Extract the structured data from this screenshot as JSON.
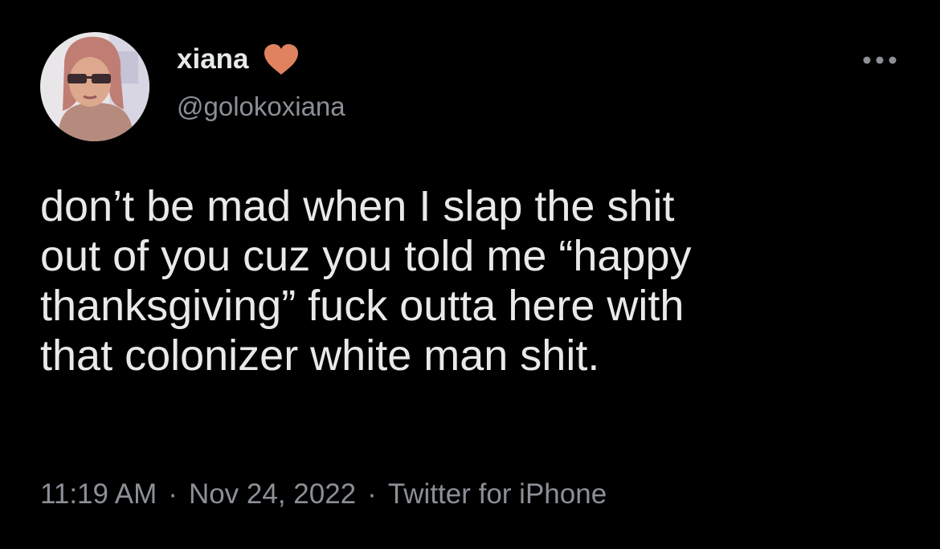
{
  "author": {
    "display_name": "xiana",
    "handle": "@golokoxiana",
    "badge_icon": "heart-icon",
    "badge_color": "#e0825f"
  },
  "menu": {
    "icon": "more-horizontal-icon"
  },
  "tweet": {
    "text_lines": [
      "don’t be mad when I slap the shit",
      "out of you cuz you told me “happy",
      "thanksgiving” fuck outta here with",
      "that colonizer white man shit."
    ],
    "time": "11:19 AM",
    "separator": "·",
    "date": "Nov 24, 2022",
    "source": "Twitter for iPhone"
  },
  "colors": {
    "background": "#000000",
    "primary_text": "#e7e9ea",
    "secondary_text": "#8b9096"
  }
}
